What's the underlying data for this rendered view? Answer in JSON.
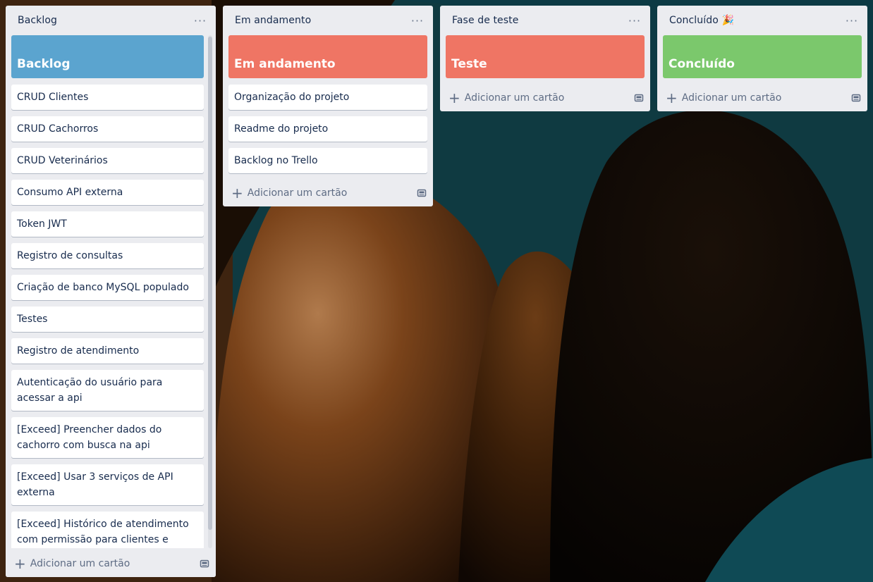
{
  "lists": [
    {
      "title": "Backlog",
      "menu": "···",
      "cover": {
        "label": "Backlog",
        "color": "#5ba4cf"
      },
      "cards": [
        "CRUD Clientes",
        "CRUD Cachorros",
        "CRUD Veterinários",
        "Consumo API externa",
        "Token JWT",
        "Registro de consultas",
        "Criação de banco MySQL populado",
        "Testes",
        "Registro de atendimento",
        "Autenticação do usuário para acessar a api",
        "[Exceed] Preencher dados do cachorro com busca na api",
        "[Exceed] Usar 3 serviços de API externa",
        "[Exceed] Histórico de atendimento com permissão para clientes e médicos"
      ],
      "add_card": "Adicionar um cartão"
    },
    {
      "title": "Em andamento",
      "menu": "···",
      "cover": {
        "label": "Em andamento",
        "color": "#ef7564"
      },
      "cards": [
        "Organização do projeto",
        "Readme do projeto",
        "Backlog no Trello"
      ],
      "add_card": "Adicionar um cartão"
    },
    {
      "title": "Fase de teste",
      "menu": "···",
      "cover": {
        "label": "Teste",
        "color": "#ef7564"
      },
      "cards": [],
      "add_card": "Adicionar um cartão"
    },
    {
      "title": "Concluído 🎉",
      "menu": "···",
      "cover": {
        "label": "Concluído",
        "color": "#7bc86c"
      },
      "cards": [],
      "add_card": "Adicionar um cartão"
    }
  ],
  "icons": {
    "menu": "ellipsis-icon",
    "add": "plus-icon",
    "template": "card-template-icon"
  }
}
